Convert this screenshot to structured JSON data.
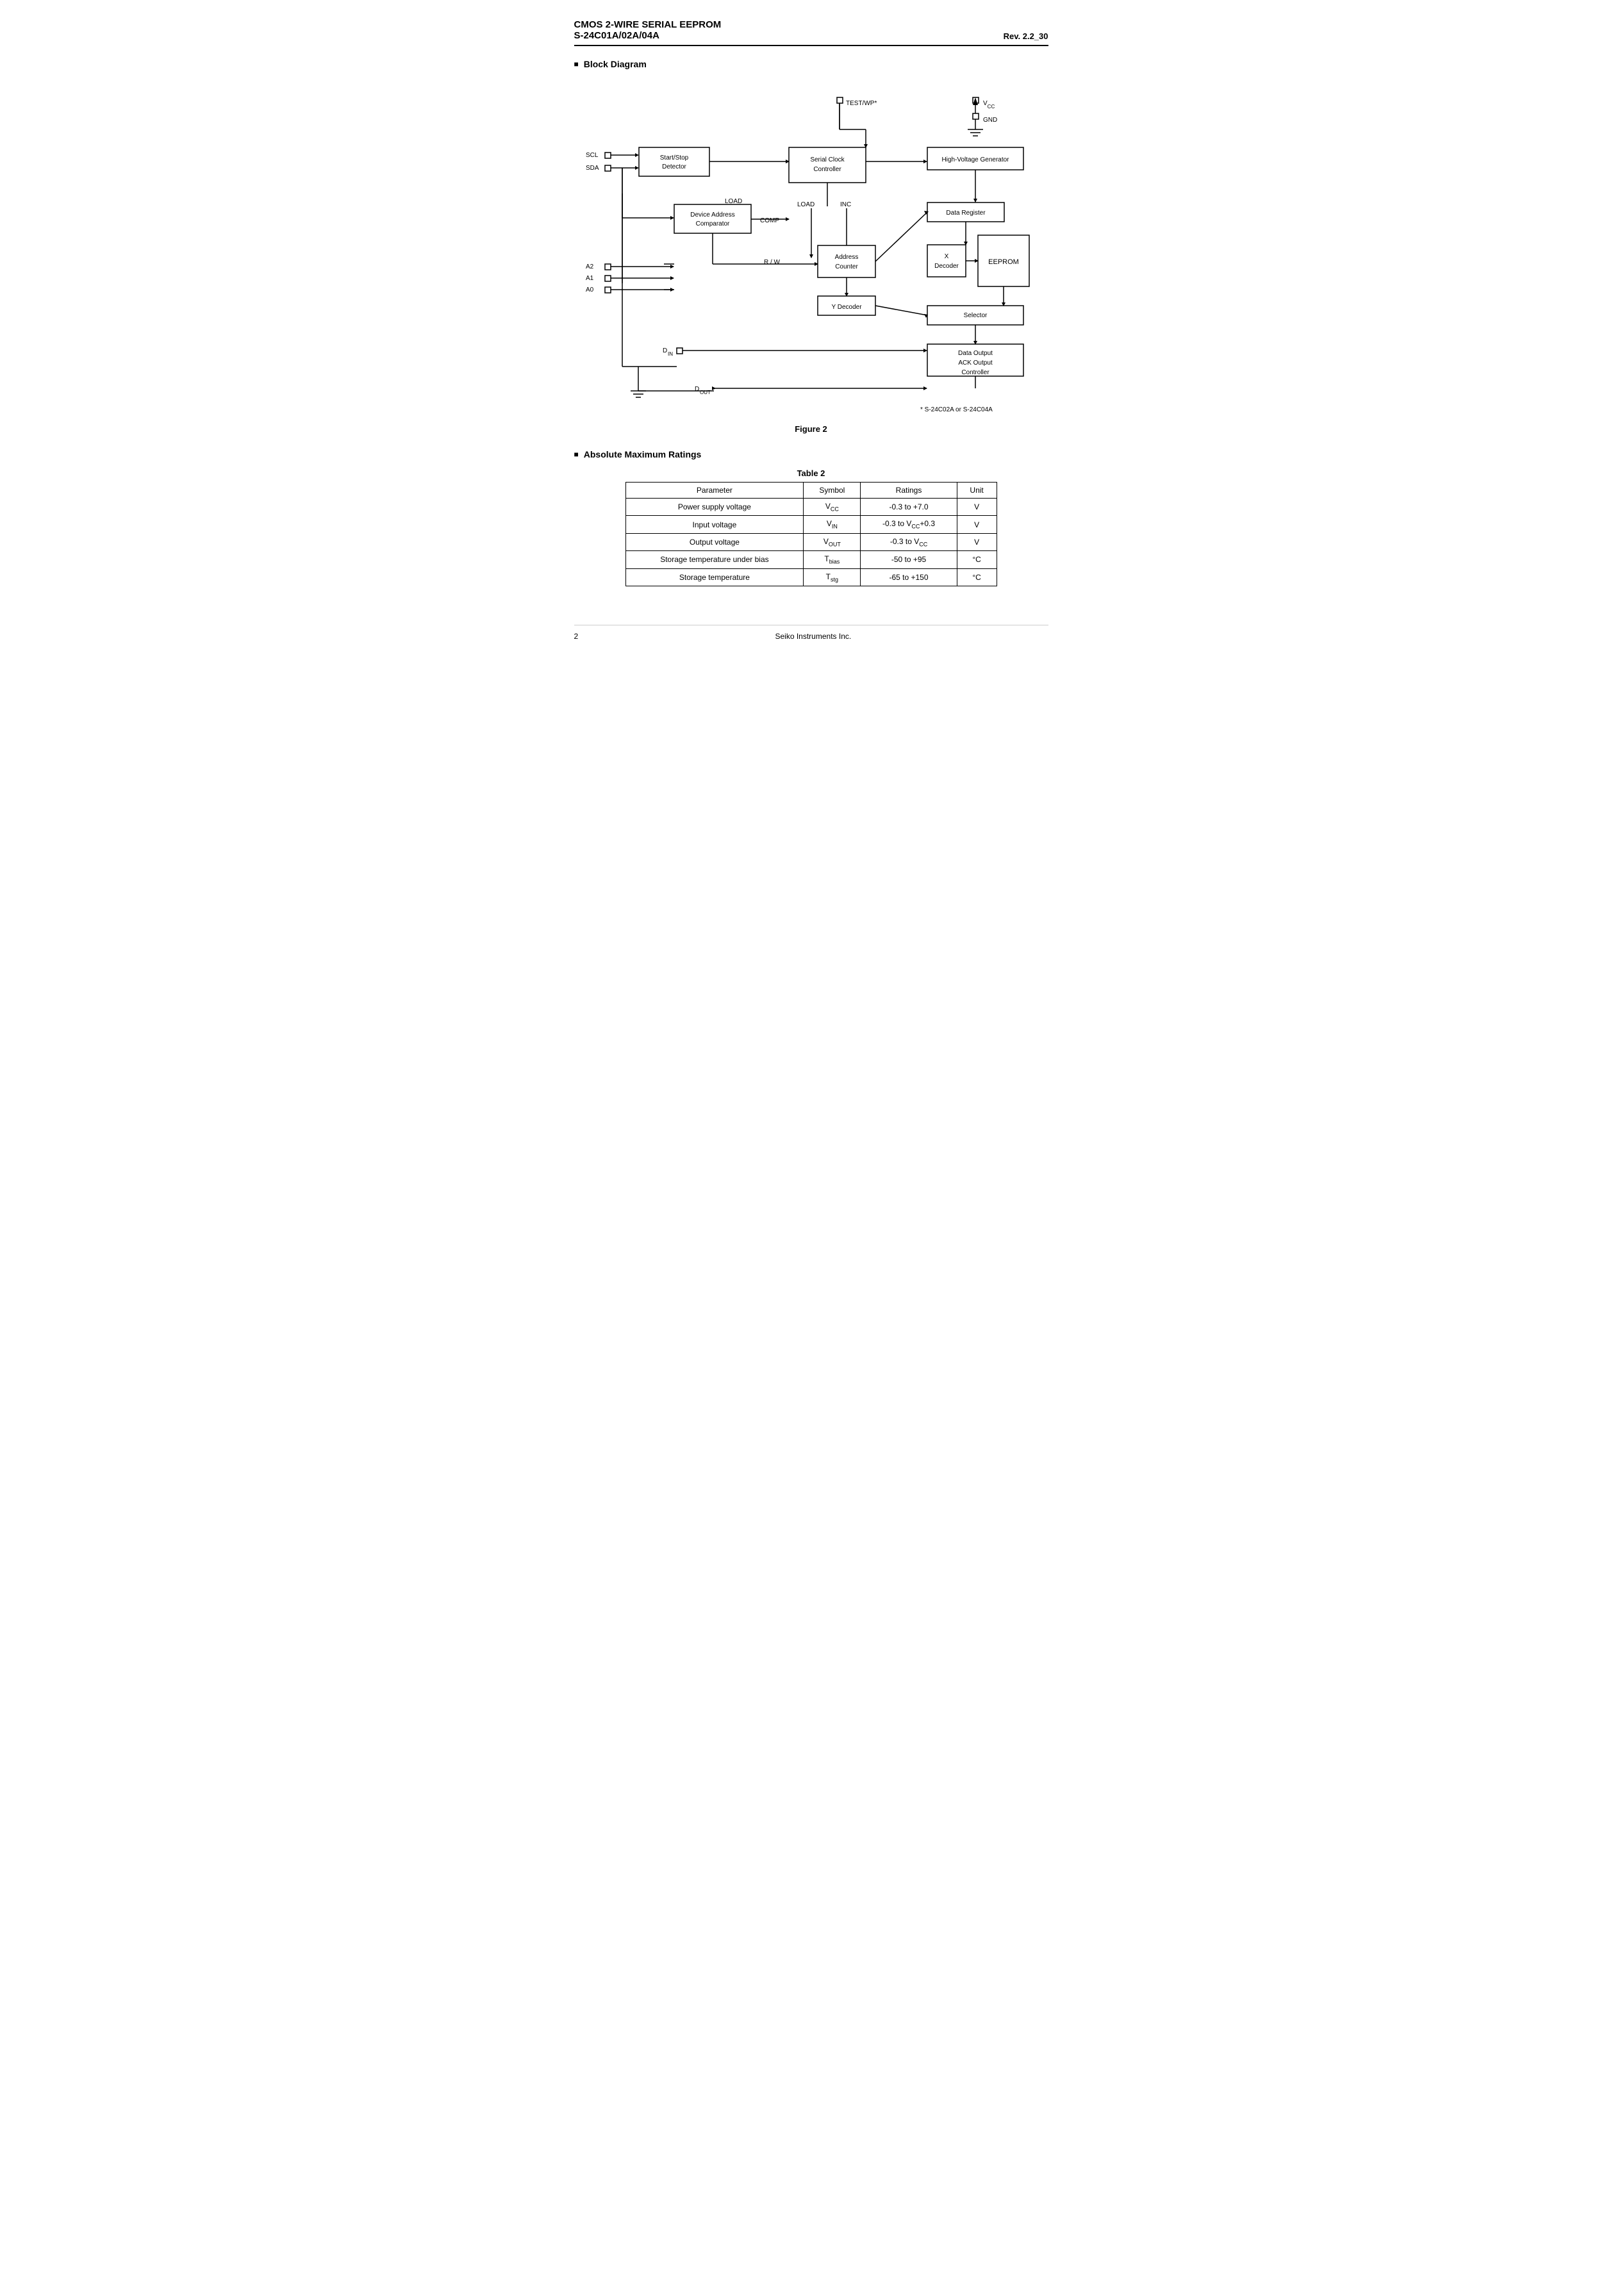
{
  "header": {
    "line1": "CMOS 2-WIRE SERIAL  EEPROM",
    "line2": "S-24C01A/02A/04A",
    "rev": "Rev. 2.2_30"
  },
  "sections": {
    "block_diagram": {
      "title": "Block Diagram",
      "figure_caption": "Figure 2",
      "footnote": "*   S-24C02A or S-24C04A",
      "blocks": {
        "start_stop": "Start/Stop\nDetector",
        "serial_clock": "Serial Clock\nController",
        "hv_gen": "High-Voltage Generator",
        "device_addr": "Device Address\nComparator",
        "data_register": "Data Register",
        "x_decoder": "X\nDecoder",
        "eeprom": "EEPROM",
        "addr_counter": "Address\nCounter",
        "y_decoder": "Y Decoder",
        "selector": "Selector",
        "data_output": "Data Output\nACK Output\nController"
      },
      "pins": {
        "scl": "SCL",
        "sda": "SDA",
        "a2": "A2",
        "a1": "A1",
        "a0": "A0",
        "din": "Dₑₙ",
        "dout": "Dₒᵁᵀ",
        "test_wp": "TEST/WP*",
        "vcc": "Vᴄᴄ",
        "gnd": "GND"
      },
      "labels": {
        "load": "LOAD",
        "comp": "COMP",
        "load2": "LOAD",
        "inc": "INC",
        "rw": "R / W"
      }
    },
    "ratings": {
      "title": "Absolute Maximum Ratings",
      "table_title": "Table  2",
      "columns": [
        "Parameter",
        "Symbol",
        "Ratings",
        "Unit"
      ],
      "rows": [
        [
          "Power supply voltage",
          "V_CC",
          "-0.3 to +7.0",
          "V"
        ],
        [
          "Input voltage",
          "V_IN",
          "-0.3 to V_CC+0.3",
          "V"
        ],
        [
          "Output voltage",
          "V_OUT",
          "-0.3 to V_CC",
          "V"
        ],
        [
          "Storage temperature under bias",
          "T_bias",
          "-50 to +95",
          "°C"
        ],
        [
          "Storage temperature",
          "T_stg",
          "-65 to +150",
          "°C"
        ]
      ]
    }
  },
  "footer": {
    "page": "2",
    "company": "Seiko Instruments Inc."
  }
}
